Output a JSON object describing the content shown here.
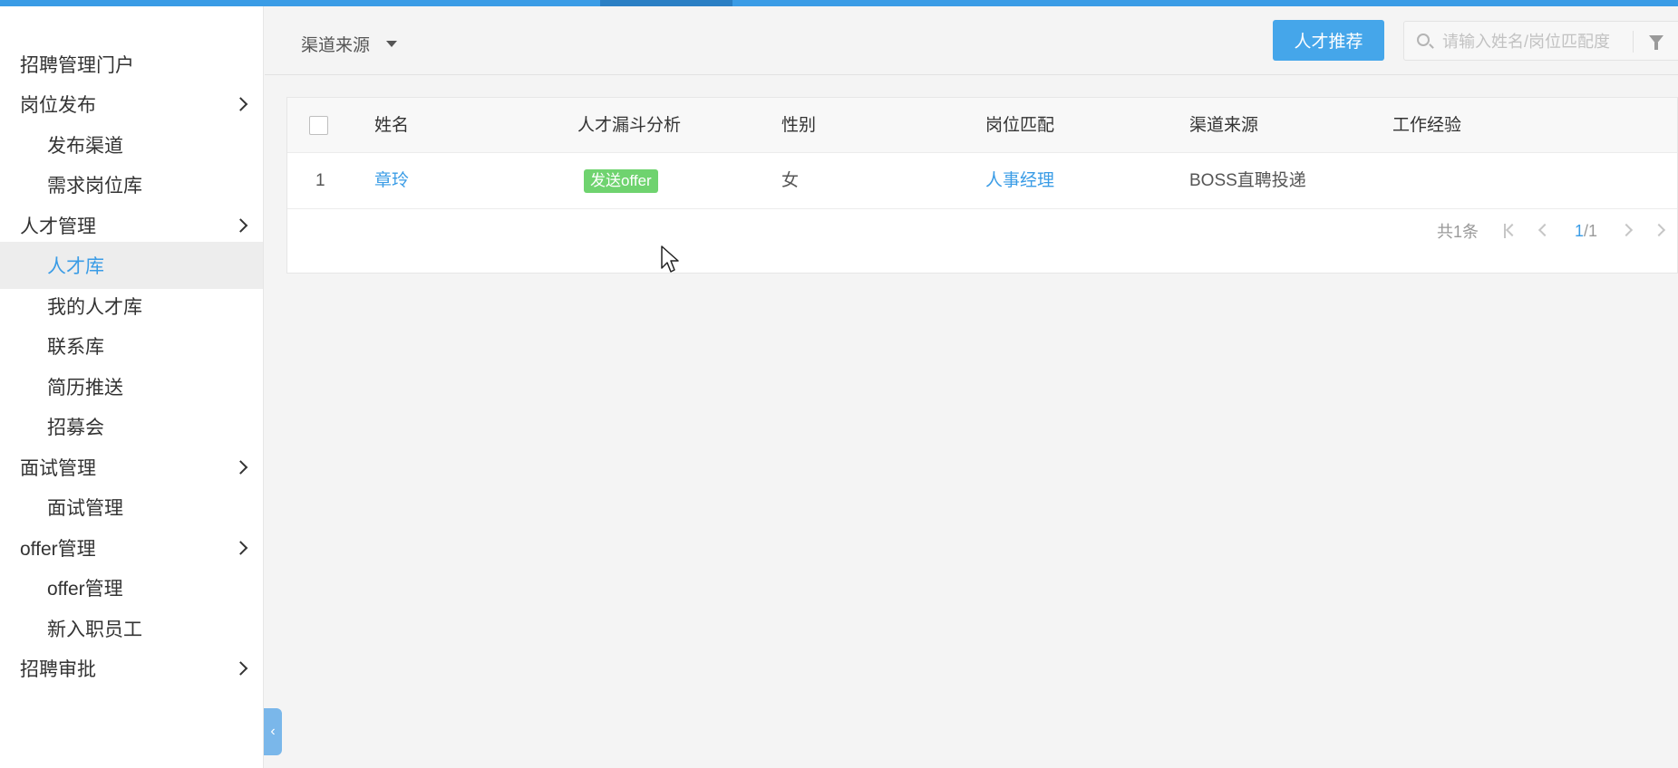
{
  "sidebar": {
    "items": [
      {
        "label": "招聘管理门户"
      },
      {
        "label": "岗位发布"
      },
      {
        "label": "发布渠道"
      },
      {
        "label": "需求岗位库"
      },
      {
        "label": "人才管理"
      },
      {
        "label": "人才库"
      },
      {
        "label": "我的人才库"
      },
      {
        "label": "联系库"
      },
      {
        "label": "简历推送"
      },
      {
        "label": "招募会"
      },
      {
        "label": "面试管理"
      },
      {
        "label": "面试管理"
      },
      {
        "label": "offer管理"
      },
      {
        "label": "offer管理"
      },
      {
        "label": "新入职员工"
      },
      {
        "label": "招聘审批"
      }
    ]
  },
  "header": {
    "channel_filter": "渠道来源",
    "recommend_button": "人才推荐",
    "search_placeholder": "请输入姓名/岗位匹配度"
  },
  "table": {
    "columns": [
      "姓名",
      "人才漏斗分析",
      "性别",
      "岗位匹配",
      "渠道来源",
      "工作经验"
    ],
    "rows": [
      {
        "index": "1",
        "name": "章玲",
        "funnel": "发送offer",
        "gender": "女",
        "position": "人事经理",
        "channel": "BOSS直聘投递",
        "experience": ""
      }
    ]
  },
  "pager": {
    "total": "共1条",
    "current": "1",
    "pages": "/1"
  },
  "colors": {
    "accent": "#3a9ce6",
    "tag_green": "#6fd36f"
  }
}
